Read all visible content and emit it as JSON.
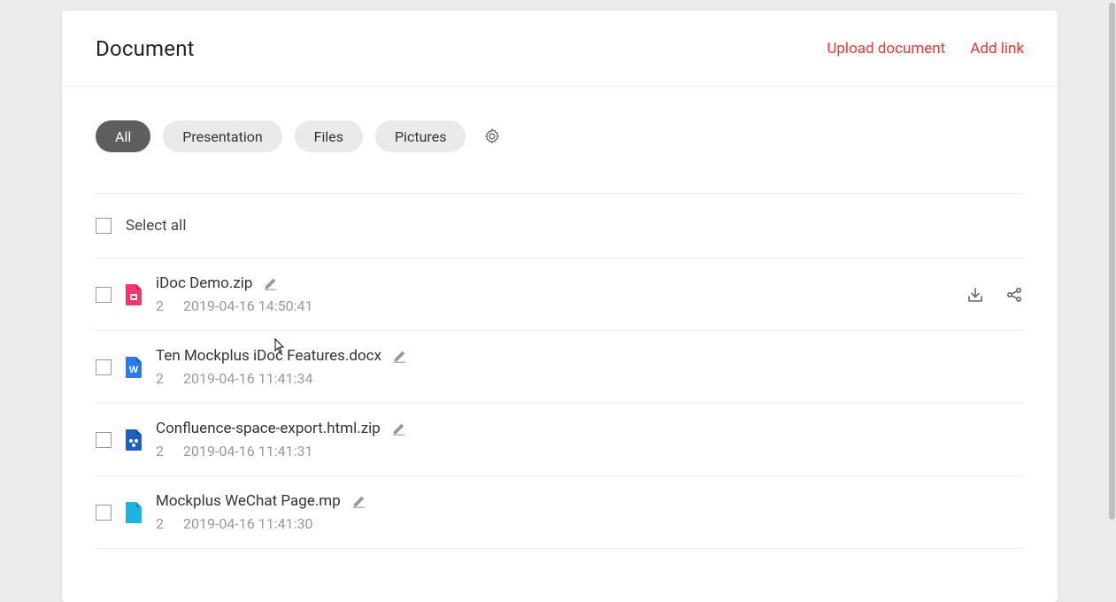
{
  "header": {
    "title": "Document",
    "upload_label": "Upload document",
    "add_link_label": "Add link"
  },
  "tabs": [
    {
      "label": "All",
      "active": true
    },
    {
      "label": "Presentation",
      "active": false
    },
    {
      "label": "Files",
      "active": false
    },
    {
      "label": "Pictures",
      "active": false
    }
  ],
  "select_all_label": "Select all",
  "files": [
    {
      "name": "iDoc Demo.zip",
      "count": "2",
      "timestamp": "2019-04-16 14:50:41",
      "icon": "zip-pink",
      "show_actions": true
    },
    {
      "name": "Ten Mockplus iDoc Features.docx",
      "count": "2",
      "timestamp": "2019-04-16 11:41:34",
      "icon": "docx-blue",
      "show_actions": false
    },
    {
      "name": "Confluence-space-export.html.zip",
      "count": "2",
      "timestamp": "2019-04-16 11:41:31",
      "icon": "zip-blue",
      "show_actions": false
    },
    {
      "name": "Mockplus WeChat Page.mp",
      "count": "2",
      "timestamp": "2019-04-16 11:41:30",
      "icon": "mp-cyan",
      "show_actions": false
    }
  ],
  "colors": {
    "accent": "#e83838",
    "zip_pink": "#f0376d",
    "docx_blue": "#2a7be4",
    "zip_blue": "#1f5fbf",
    "mp_cyan": "#1fb3e0"
  }
}
